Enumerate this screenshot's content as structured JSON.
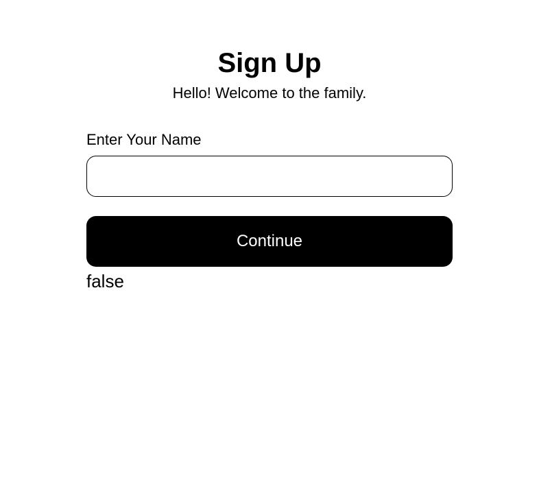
{
  "header": {
    "title": "Sign Up",
    "subtitle": "Hello! Welcome to the family."
  },
  "form": {
    "name_label": "Enter Your Name",
    "name_value": "",
    "continue_label": "Continue"
  },
  "status": {
    "text": "false"
  }
}
